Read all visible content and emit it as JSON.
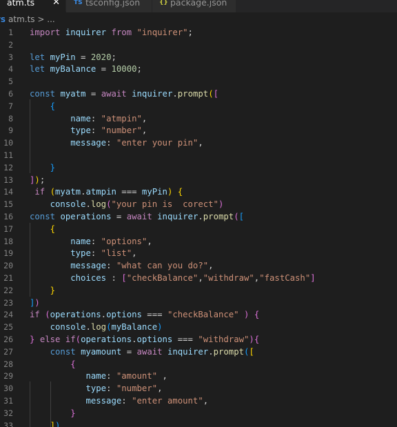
{
  "tabs": [
    {
      "label": "atm.ts",
      "icon": "typescript-file-icon",
      "active": true,
      "close": "✕"
    },
    {
      "label": "tsconfig.json",
      "icon": "tsconfig-file-icon",
      "active": false
    },
    {
      "label": "package.json",
      "icon": "json-file-icon",
      "active": false
    }
  ],
  "tab_icons": {
    "ts": "TS",
    "json": "{}"
  },
  "breadcrumb": {
    "file": "atm.ts",
    "separator": ">",
    "rest": "..."
  },
  "colors": {
    "keyword": "#c586c0",
    "declaration": "#569cd6",
    "variable": "#9cdcfe",
    "function": "#dcdcaa",
    "string": "#ce9178",
    "number": "#b5cea8",
    "bracket_level1": "#ffd700",
    "bracket_level2": "#da70d6",
    "bracket_level3": "#179fff",
    "background": "#1e1e1e",
    "line_number": "#858585"
  },
  "code_lines": [
    {
      "n": "1",
      "tokens": [
        [
          "kw",
          "import"
        ],
        [
          "op",
          " "
        ],
        [
          "var",
          "inquirer"
        ],
        [
          "op",
          " "
        ],
        [
          "kw",
          "from"
        ],
        [
          "op",
          " "
        ],
        [
          "str",
          "\"inquirer\""
        ],
        [
          "op",
          ";"
        ]
      ]
    },
    {
      "n": "2",
      "tokens": []
    },
    {
      "n": "3",
      "tokens": [
        [
          "decl",
          "let"
        ],
        [
          "op",
          " "
        ],
        [
          "var",
          "myPin"
        ],
        [
          "op",
          " = "
        ],
        [
          "num",
          "2020"
        ],
        [
          "op",
          ";"
        ]
      ]
    },
    {
      "n": "4",
      "tokens": [
        [
          "decl",
          "let"
        ],
        [
          "op",
          " "
        ],
        [
          "var",
          "myBalance"
        ],
        [
          "op",
          " = "
        ],
        [
          "num",
          "10000"
        ],
        [
          "op",
          ";"
        ]
      ]
    },
    {
      "n": "5",
      "tokens": []
    },
    {
      "n": "6",
      "tokens": [
        [
          "decl",
          "const"
        ],
        [
          "op",
          " "
        ],
        [
          "var",
          "myatm"
        ],
        [
          "op",
          " = "
        ],
        [
          "kw",
          "await"
        ],
        [
          "op",
          " "
        ],
        [
          "var",
          "inquirer"
        ],
        [
          "op",
          "."
        ],
        [
          "fn",
          "prompt"
        ],
        [
          "br1",
          "("
        ],
        [
          "br2",
          "["
        ]
      ]
    },
    {
      "n": "7",
      "tokens": [
        [
          "op",
          "    "
        ],
        [
          "br3",
          "{"
        ]
      ]
    },
    {
      "n": "8",
      "tokens": [
        [
          "op",
          "        "
        ],
        [
          "var",
          "name"
        ],
        [
          "op",
          ": "
        ],
        [
          "str",
          "\"atmpin\""
        ],
        [
          "op",
          ","
        ]
      ]
    },
    {
      "n": "9",
      "tokens": [
        [
          "op",
          "        "
        ],
        [
          "var",
          "type"
        ],
        [
          "op",
          ": "
        ],
        [
          "str",
          "\"number\""
        ],
        [
          "op",
          ","
        ]
      ]
    },
    {
      "n": "10",
      "tokens": [
        [
          "op",
          "        "
        ],
        [
          "var",
          "message"
        ],
        [
          "op",
          ": "
        ],
        [
          "str",
          "\"enter your pin\""
        ],
        [
          "op",
          ","
        ]
      ]
    },
    {
      "n": "11",
      "tokens": []
    },
    {
      "n": "12",
      "tokens": [
        [
          "op",
          "    "
        ],
        [
          "br3",
          "}"
        ]
      ]
    },
    {
      "n": "13",
      "tokens": [
        [
          "br2",
          "]"
        ],
        [
          "br1",
          ")"
        ],
        [
          "op",
          ";"
        ]
      ]
    },
    {
      "n": "14",
      "tokens": [
        [
          "op",
          " "
        ],
        [
          "kw",
          "if"
        ],
        [
          "op",
          " "
        ],
        [
          "br1",
          "("
        ],
        [
          "var",
          "myatm"
        ],
        [
          "op",
          "."
        ],
        [
          "var",
          "atmpin"
        ],
        [
          "op",
          " === "
        ],
        [
          "var",
          "myPin"
        ],
        [
          "br1",
          ")"
        ],
        [
          "op",
          " "
        ],
        [
          "br1",
          "{"
        ]
      ]
    },
    {
      "n": "15",
      "tokens": [
        [
          "op",
          "    "
        ],
        [
          "var",
          "console"
        ],
        [
          "op",
          "."
        ],
        [
          "fn",
          "log"
        ],
        [
          "br2",
          "("
        ],
        [
          "str",
          "\"your pin is  corect\""
        ],
        [
          "br2",
          ")"
        ]
      ]
    },
    {
      "n": "16",
      "tokens": [
        [
          "decl",
          "const"
        ],
        [
          "op",
          " "
        ],
        [
          "var",
          "operations"
        ],
        [
          "op",
          " = "
        ],
        [
          "kw",
          "await"
        ],
        [
          "op",
          " "
        ],
        [
          "var",
          "inquirer"
        ],
        [
          "op",
          "."
        ],
        [
          "fn",
          "prompt"
        ],
        [
          "br2",
          "("
        ],
        [
          "br3",
          "["
        ]
      ]
    },
    {
      "n": "17",
      "tokens": [
        [
          "op",
          "    "
        ],
        [
          "br1",
          "{"
        ]
      ]
    },
    {
      "n": "18",
      "tokens": [
        [
          "op",
          "        "
        ],
        [
          "var",
          "name"
        ],
        [
          "op",
          ": "
        ],
        [
          "str",
          "\"options\""
        ],
        [
          "op",
          ","
        ]
      ]
    },
    {
      "n": "19",
      "tokens": [
        [
          "op",
          "        "
        ],
        [
          "var",
          "type"
        ],
        [
          "op",
          ": "
        ],
        [
          "str",
          "\"list\""
        ],
        [
          "op",
          ","
        ]
      ]
    },
    {
      "n": "20",
      "tokens": [
        [
          "op",
          "        "
        ],
        [
          "var",
          "message"
        ],
        [
          "op",
          ": "
        ],
        [
          "str",
          "\"what can you do?\""
        ],
        [
          "op",
          ","
        ]
      ]
    },
    {
      "n": "21",
      "tokens": [
        [
          "op",
          "        "
        ],
        [
          "var",
          "choices"
        ],
        [
          "op",
          " : "
        ],
        [
          "br2",
          "["
        ],
        [
          "str",
          "\"checkBalance\""
        ],
        [
          "op",
          ","
        ],
        [
          "str",
          "\"withdraw\""
        ],
        [
          "op",
          ","
        ],
        [
          "str",
          "\"fastCash\""
        ],
        [
          "br2",
          "]"
        ]
      ]
    },
    {
      "n": "22",
      "tokens": [
        [
          "op",
          "    "
        ],
        [
          "br1",
          "}"
        ]
      ]
    },
    {
      "n": "23",
      "tokens": [
        [
          "br3",
          "]"
        ],
        [
          "br2",
          ")"
        ]
      ]
    },
    {
      "n": "24",
      "tokens": [
        [
          "kw",
          "if"
        ],
        [
          "op",
          " "
        ],
        [
          "br2",
          "("
        ],
        [
          "var",
          "operations"
        ],
        [
          "op",
          "."
        ],
        [
          "var",
          "options"
        ],
        [
          "op",
          " === "
        ],
        [
          "str",
          "\"checkBalance\""
        ],
        [
          "op",
          " "
        ],
        [
          "br2",
          ")"
        ],
        [
          "op",
          " "
        ],
        [
          "br2",
          "{"
        ]
      ]
    },
    {
      "n": "25",
      "tokens": [
        [
          "op",
          "    "
        ],
        [
          "var",
          "console"
        ],
        [
          "op",
          "."
        ],
        [
          "fn",
          "log"
        ],
        [
          "br3",
          "("
        ],
        [
          "var",
          "myBalance"
        ],
        [
          "br3",
          ")"
        ]
      ]
    },
    {
      "n": "26",
      "tokens": [
        [
          "br2",
          "}"
        ],
        [
          "op",
          " "
        ],
        [
          "kw",
          "else"
        ],
        [
          "op",
          " "
        ],
        [
          "kw",
          "if"
        ],
        [
          "br2",
          "("
        ],
        [
          "var",
          "operations"
        ],
        [
          "op",
          "."
        ],
        [
          "var",
          "options"
        ],
        [
          "op",
          " === "
        ],
        [
          "str",
          "\"withdraw\""
        ],
        [
          "br2",
          ")"
        ],
        [
          "br2",
          "{"
        ]
      ]
    },
    {
      "n": "27",
      "tokens": [
        [
          "op",
          "    "
        ],
        [
          "decl",
          "const"
        ],
        [
          "op",
          " "
        ],
        [
          "var",
          "myamount"
        ],
        [
          "op",
          " = "
        ],
        [
          "kw",
          "await"
        ],
        [
          "op",
          " "
        ],
        [
          "var",
          "inquirer"
        ],
        [
          "op",
          "."
        ],
        [
          "fn",
          "prompt"
        ],
        [
          "br3",
          "("
        ],
        [
          "br1",
          "["
        ]
      ]
    },
    {
      "n": "28",
      "tokens": [
        [
          "op",
          "        "
        ],
        [
          "br2",
          "{"
        ]
      ]
    },
    {
      "n": "29",
      "tokens": [
        [
          "op",
          "           "
        ],
        [
          "var",
          "name"
        ],
        [
          "op",
          ": "
        ],
        [
          "str",
          "\"amount\""
        ],
        [
          "op",
          " ,"
        ]
      ]
    },
    {
      "n": "30",
      "tokens": [
        [
          "op",
          "           "
        ],
        [
          "var",
          "type"
        ],
        [
          "op",
          ": "
        ],
        [
          "str",
          "\"number\""
        ],
        [
          "op",
          ","
        ]
      ]
    },
    {
      "n": "31",
      "tokens": [
        [
          "op",
          "           "
        ],
        [
          "var",
          "message"
        ],
        [
          "op",
          ": "
        ],
        [
          "str",
          "\"enter amount\""
        ],
        [
          "op",
          ","
        ]
      ]
    },
    {
      "n": "32",
      "tokens": [
        [
          "op",
          "        "
        ],
        [
          "br2",
          "}"
        ]
      ]
    },
    {
      "n": "33",
      "tokens": [
        [
          "op",
          "    "
        ],
        [
          "br1",
          "]"
        ],
        [
          "br3",
          ")"
        ]
      ]
    }
  ]
}
